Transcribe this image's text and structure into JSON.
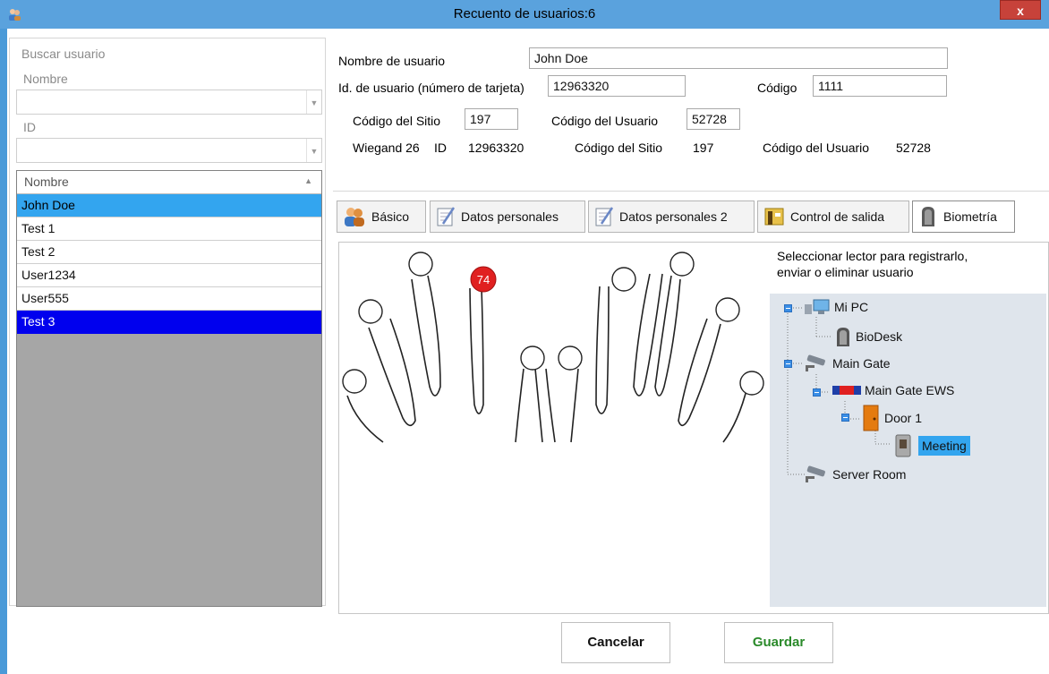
{
  "window": {
    "title": "Recuento de usuarios:6",
    "close_label": "x"
  },
  "search": {
    "heading": "Buscar usuario",
    "name_label": "Nombre",
    "name_value": "",
    "id_label": "ID",
    "id_value": ""
  },
  "user_list": {
    "column_header": "Nombre",
    "rows": [
      "John Doe",
      "Test 1",
      "Test 2",
      "User1234",
      "User555",
      "Test 3"
    ]
  },
  "form": {
    "username_label": "Nombre de usuario",
    "username_value": "John Doe",
    "userid_label": "Id. de usuario (número de tarjeta)",
    "userid_value": "12963320",
    "code_label": "Código",
    "code_value": "1111",
    "site_code_label": "Código del Sitio",
    "site_code_value": "197",
    "user_code_label": "Código del Usuario",
    "user_code_value": "52728",
    "wiegand_label": "Wiegand 26",
    "wiegand_id_label": "ID",
    "wiegand_id_value": "12963320",
    "wiegand_site_label": "Código del Sitio",
    "wiegand_site_value": "197",
    "wiegand_user_label": "Código del Usuario",
    "wiegand_user_value": "52728"
  },
  "tabs": [
    {
      "label": "Básico",
      "icon": "users-icon"
    },
    {
      "label": "Datos personales",
      "icon": "notepad-icon"
    },
    {
      "label": "Datos personales 2",
      "icon": "notepad-icon"
    },
    {
      "label": "Control de salida",
      "icon": "exit-control-icon"
    },
    {
      "label": "Biometría",
      "icon": "fingerprint-reader-icon"
    }
  ],
  "biometrics": {
    "finger_badge": "74",
    "instruction_line1": "Seleccionar lector para registrarlo,",
    "instruction_line2": "enviar o eliminar usuario"
  },
  "device_tree": {
    "nodes": [
      "Mi PC",
      "BioDesk",
      "Main Gate",
      "Main Gate EWS",
      "Door 1",
      "Meeting",
      "Server Room"
    ]
  },
  "buttons": {
    "cancel": "Cancelar",
    "save": "Guardar"
  },
  "colors": {
    "selected_row": "#33a5ef",
    "highlight_row": "#0000ee",
    "badge": "#e02020",
    "save_text": "#2a8a2a"
  }
}
